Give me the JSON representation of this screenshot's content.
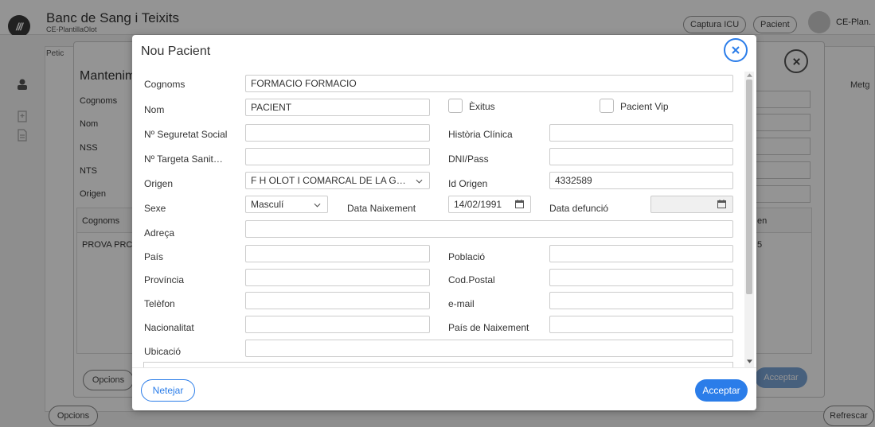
{
  "app": {
    "title": "Banc de Sang i Teixits",
    "subtitle": "CE-PlantillaOlot",
    "logo_text": "///",
    "captura_icu": "Captura ICU",
    "pacient": "Pacient",
    "user": "CE-Plan.",
    "tab_peticions": "Petic",
    "metge": "Metg",
    "opcions": "Opcions",
    "refrescar": "Refrescar"
  },
  "manteniment": {
    "title": "Mantenim",
    "labels": [
      "Cognoms",
      "Nom",
      "NSS",
      "NTS",
      "Origen"
    ],
    "table_head_cognoms": "Cognoms",
    "table_head_origen": "en",
    "row_cognoms": "PROVA PRC",
    "row_origen": "5",
    "opcions": "Opcions",
    "acceptar": "Acceptar"
  },
  "modal": {
    "title": "Nou Pacient",
    "netejar": "Netejar",
    "acceptar": "Acceptar",
    "colors": {
      "accent": "#2b7de9"
    },
    "fields": {
      "cognoms": {
        "label": "Cognoms",
        "value": "FORMACIO FORMACIO"
      },
      "nom": {
        "label": "Nom",
        "value": "PACIENT"
      },
      "exitus": {
        "label": "Èxitus",
        "checked": false
      },
      "pacient_vip": {
        "label": "Pacient Vip",
        "checked": false
      },
      "nss": {
        "label": "Nº Seguretat Social",
        "value": ""
      },
      "historia": {
        "label": "Història Clínica",
        "value": ""
      },
      "nts": {
        "label": "Nº Targeta Sanit…",
        "value": ""
      },
      "dni": {
        "label": "DNI/Pass",
        "value": ""
      },
      "origen": {
        "label": "Origen",
        "value": "F H OLOT I COMARCAL DE LA G…"
      },
      "id_origen": {
        "label": "Id Origen",
        "value": "4332589"
      },
      "sexe": {
        "label": "Sexe",
        "value": "Masculí"
      },
      "data_naixement": {
        "label": "Data Naixement",
        "value": "14/02/1991"
      },
      "data_defuncio": {
        "label": "Data defunció",
        "value": ""
      },
      "adreca": {
        "label": "Adreça",
        "value": ""
      },
      "pais": {
        "label": "País",
        "value": ""
      },
      "poblacio": {
        "label": "Població",
        "value": ""
      },
      "provincia": {
        "label": "Província",
        "value": ""
      },
      "cod_postal": {
        "label": "Cod.Postal",
        "value": ""
      },
      "telefon": {
        "label": "Telèfon",
        "value": ""
      },
      "email": {
        "label": "e-mail",
        "value": ""
      },
      "nacionalitat": {
        "label": "Nacionalitat",
        "value": ""
      },
      "pais_naixement": {
        "label": "País de Naixement",
        "value": ""
      },
      "ubicacio": {
        "label": "Ubicació",
        "value": ""
      }
    }
  }
}
